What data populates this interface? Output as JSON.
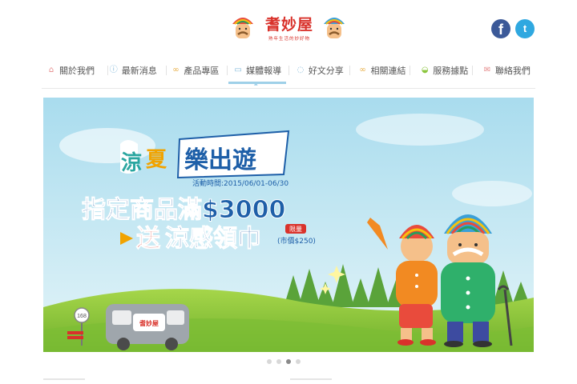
{
  "header": {
    "logo_text": "耆妙屋",
    "logo_sub": "熟年生活的妙好物",
    "social": {
      "facebook": "f",
      "twitter": "t"
    }
  },
  "nav": {
    "items": [
      {
        "label": "關於我們",
        "icon": "home-icon"
      },
      {
        "label": "最新消息",
        "icon": "info-icon"
      },
      {
        "label": "產品專區",
        "icon": "glasses-icon"
      },
      {
        "label": "媒體報導",
        "icon": "camera-icon",
        "active": true
      },
      {
        "label": "好文分享",
        "icon": "chat-icon"
      },
      {
        "label": "相關連結",
        "icon": "link-icon"
      },
      {
        "label": "服務據點",
        "icon": "car-icon"
      },
      {
        "label": "聯絡我們",
        "icon": "mail-icon"
      }
    ]
  },
  "banner": {
    "title_a1": "涼",
    "title_a2": "夏",
    "title_b": "樂出遊",
    "period": "活動時間:2015/06/01-06/30",
    "line1": "指定商品滿$3000",
    "line2_a": "送",
    "line2_b": "涼感領巾",
    "limited": "限量",
    "market_price": "(市價$250)",
    "sign_number": "168",
    "bus_brand": "耆妙屋"
  },
  "carousel": {
    "count": 4,
    "active_index": 2
  },
  "colors": {
    "brand_red": "#d9322b",
    "nav_active": "#9fd0e8",
    "sky": "#bfe6f2",
    "grass": "#8cc63f",
    "promo_blue": "#1e5fa8"
  }
}
